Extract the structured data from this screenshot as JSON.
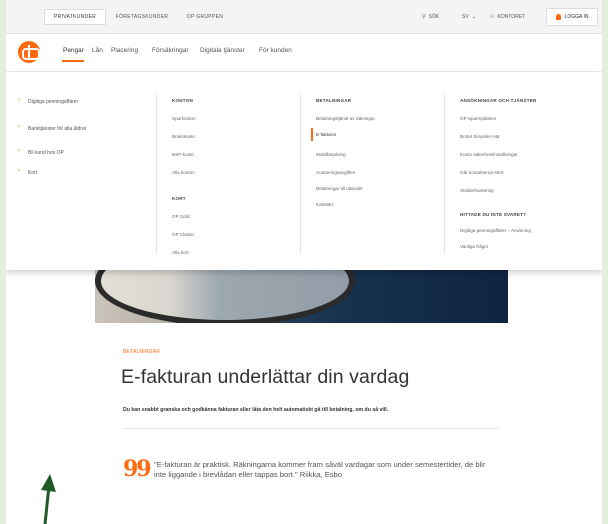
{
  "topbar": {
    "segments": [
      "PRIVATKUNDER",
      "FÖRETAGSKUNDER",
      "OP GRUPPEN"
    ],
    "search_label": "SÖK",
    "language_label": "SV",
    "region_label": "KONTORET",
    "login_label": "LOGGA IN"
  },
  "mainnav": {
    "items": [
      "Pengar",
      "Lån",
      "Placering",
      "Försäkringar",
      "Digitala tjänster",
      "För kunden"
    ],
    "active_index": 0
  },
  "megamenu": {
    "quick_links": [
      "Digitiga penningaffärer",
      "Banktjänster för alla åldrar",
      "Bli kund hos OP",
      "Kort"
    ],
    "col1": {
      "heading": "KONTON",
      "items": [
        "Sparkonton",
        "Brukskonto",
        "BSP-konto",
        "Alla konton"
      ],
      "heading2": "KORT",
      "items2": [
        "OP Gold",
        "OP Classic",
        "Alla kort"
      ]
    },
    "col2": {
      "heading": "BETALNINGAR",
      "items": [
        "Betalningstjänst av räkningar",
        "E-fakturor",
        "Mobilbetalning",
        "Autoteringsavgiften",
        "Betalningar till utlandet",
        "Kartsökt"
      ],
      "highlight_index": 1
    },
    "col3": {
      "heading": "ANSÖKNINGAR OCH TJÄNSTER",
      "items": [
        "OP Sparmplatsen",
        "Bortel Simpsler Hät",
        "Konto säkerhetsinställningar",
        "Går kontakterna-stert",
        "Stolderhantering"
      ],
      "heading2": "HITTADE DU INTE SVARET?",
      "items2": [
        "Digitiga penningaffärer – Anvisning",
        "Vanliga frågor"
      ]
    }
  },
  "article": {
    "category": "BETALNINGAR",
    "headline": "E-fakturan underlättar din vardag",
    "lead": "Du kan snabbt granska och godkänna fakturan eller låta den helt automatiskt gå till betalning, om du så vill.",
    "quote_mark": "99",
    "quote": "\"E-fakturan är praktisk. Räkningarna kommer fram såväl vardagar som under semestertider, de blir inte liggande i brevlådan eller tappas bort.\" Riikka, Esbo"
  },
  "colors": {
    "accent": "#ff6a10",
    "page_background": "#e4eedf",
    "arrow": "#1f5a24"
  }
}
